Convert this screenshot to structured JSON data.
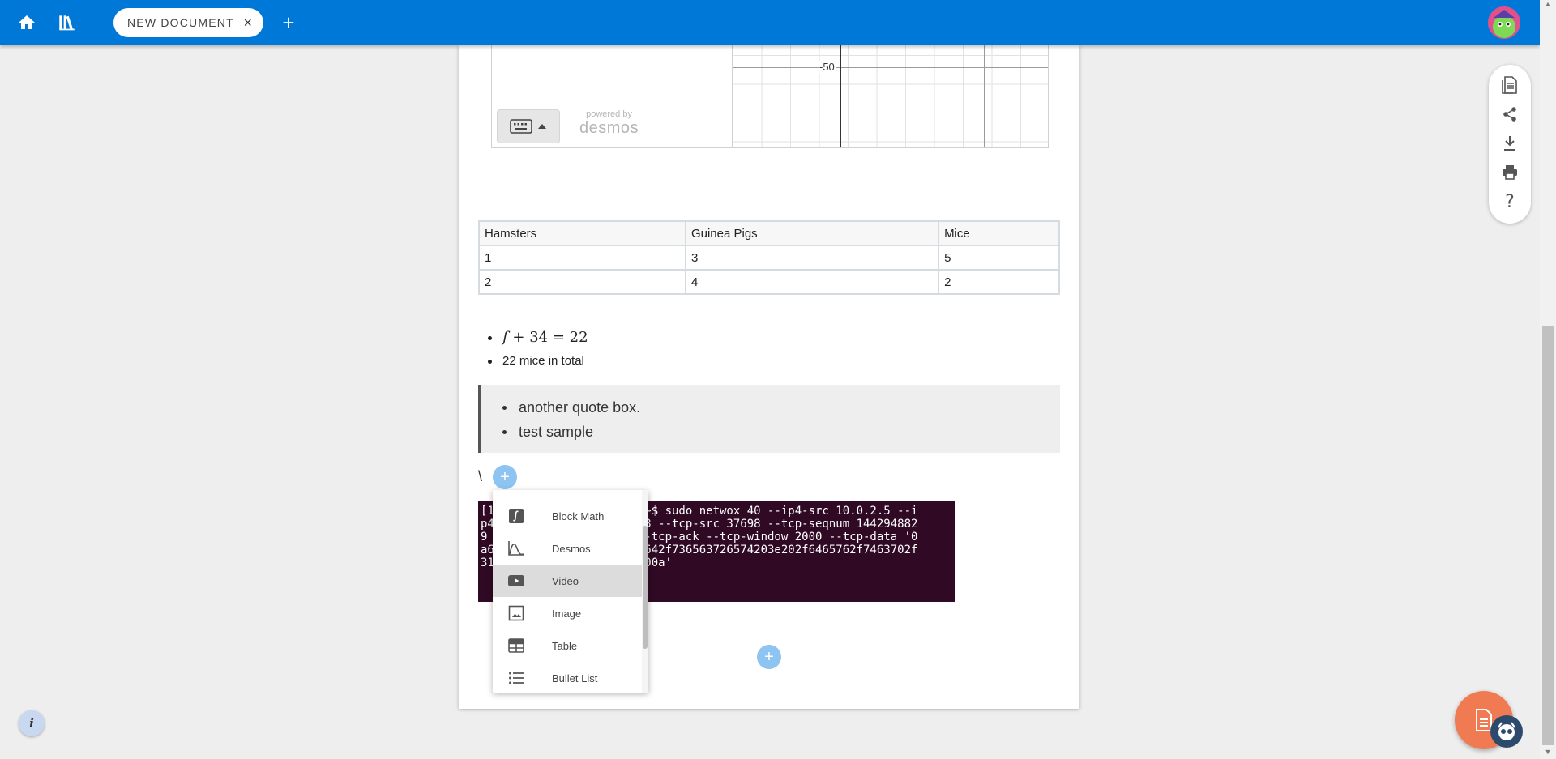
{
  "topbar": {
    "tab_label": "NEW DOCUMENT",
    "tab_close": "×",
    "new_tab": "+",
    "color": "#0078d7"
  },
  "desmos": {
    "powered_by": "powered by",
    "logo_text": "desmos",
    "y_tick_label": "-50"
  },
  "table": {
    "headers": [
      "Hamsters",
      "Guinea Pigs",
      "Mice"
    ],
    "rows": [
      [
        "1",
        "3",
        "5"
      ],
      [
        "2",
        "4",
        "2"
      ]
    ]
  },
  "bullets": {
    "math": {
      "var": "f",
      "rest": "+ 34 = 22"
    },
    "text": "22 mice in total"
  },
  "quote": {
    "items": [
      "another quote box.",
      "test sample"
    ]
  },
  "stray_text": "\\",
  "add_button": "+",
  "terminal": {
    "lines": [
      "[1                   nd:~$ sudo netwox 40 --ip4-src 10.0.2.5 --i",
      "p4                   t 23 --tcp-src 37698 --tcp-seqnum 144294882",
      "9                    9 --tcp-ack --tcp-window 2000 --tcp-data '0",
      "a6                   565642f736563726574203e202f6465762f7463702f",
      "31                   39300a'"
    ],
    "background": "#300a24"
  },
  "insert_menu": {
    "items": [
      {
        "label": "Block Math",
        "icon": "integral-icon"
      },
      {
        "label": "Desmos",
        "icon": "graph-curve-icon"
      },
      {
        "label": "Video",
        "icon": "video-icon"
      },
      {
        "label": "Image",
        "icon": "image-icon"
      },
      {
        "label": "Table",
        "icon": "table-icon"
      },
      {
        "label": "Bullet List",
        "icon": "bullet-list-icon"
      }
    ],
    "highlighted": "Video"
  },
  "side_toolbar": [
    "document-icon",
    "share-icon",
    "download-icon",
    "print-icon",
    "help-icon"
  ],
  "info_button": "i",
  "fab_color": "#f07b52"
}
